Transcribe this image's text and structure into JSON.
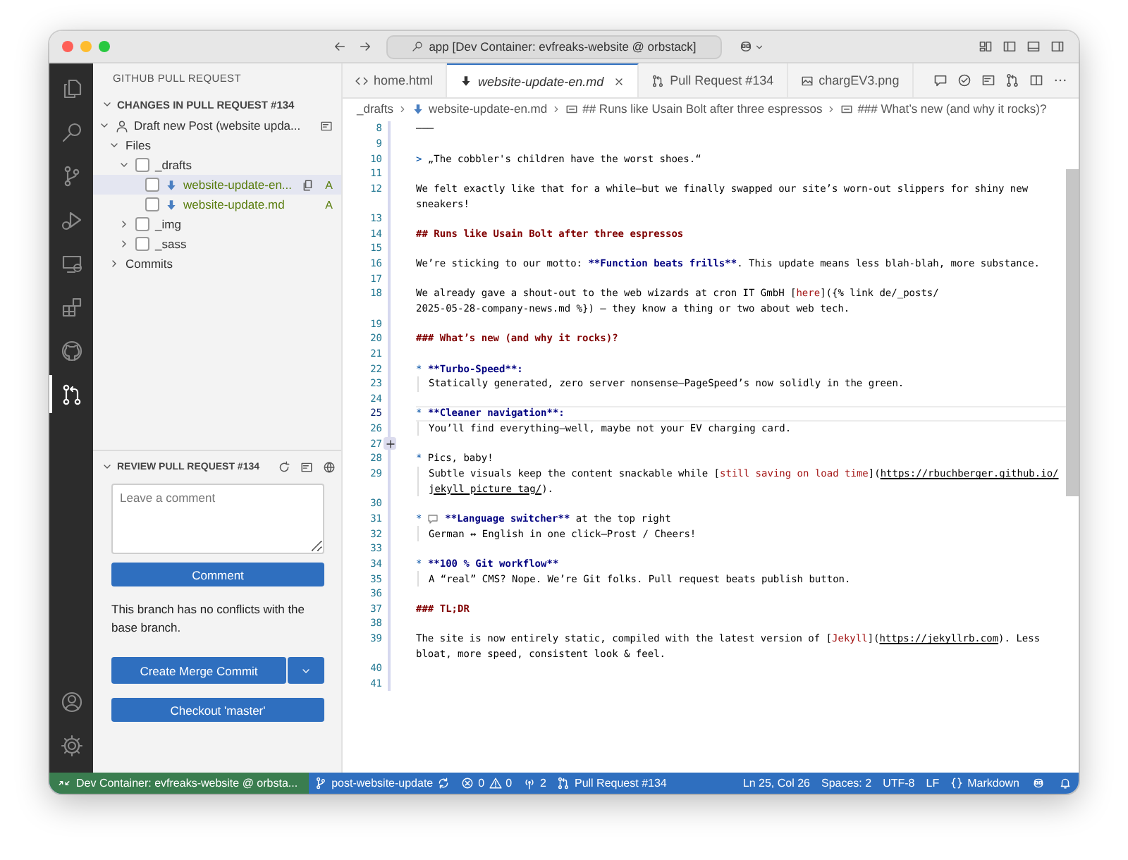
{
  "window": {
    "title": "app [Dev Container: evfreaks-website @ orbstack]"
  },
  "activity_bar": [
    {
      "kind": "files",
      "selected": false
    },
    {
      "kind": "search",
      "selected": false
    },
    {
      "kind": "branch",
      "selected": false
    },
    {
      "kind": "debug",
      "selected": false
    },
    {
      "kind": "remote",
      "selected": false
    },
    {
      "kind": "extensions",
      "selected": false
    },
    {
      "kind": "github",
      "selected": false
    },
    {
      "kind": "pr",
      "selected": true
    }
  ],
  "activity_bottom": [
    {
      "kind": "account"
    },
    {
      "kind": "gear"
    }
  ],
  "sidebar": {
    "title": "GITHUB PULL REQUEST",
    "changes": {
      "title": "CHANGES IN PULL REQUEST #134",
      "expanded": true,
      "tree": [
        {
          "kind": "pr",
          "label": "Draft new Post (website upda...",
          "expanded": true,
          "selected": false,
          "children": [
            {
              "kind": "group",
              "label": "Files",
              "expanded": true,
              "selected": false,
              "children": [
                {
                  "kind": "folder",
                  "label": "_drafts",
                  "expanded": true,
                  "checked": false,
                  "selected": false,
                  "children": [
                    {
                      "kind": "file",
                      "label": "website-update-en...",
                      "checked": false,
                      "selected": true,
                      "status": "A"
                    },
                    {
                      "kind": "file",
                      "label": "website-update.md",
                      "checked": false,
                      "selected": false,
                      "status": "A"
                    }
                  ]
                },
                {
                  "kind": "folder",
                  "label": "_img",
                  "expanded": false,
                  "checked": false,
                  "selected": false
                },
                {
                  "kind": "folder",
                  "label": "_sass",
                  "expanded": false,
                  "checked": false,
                  "selected": false
                }
              ]
            },
            {
              "kind": "group",
              "label": "Commits",
              "expanded": false,
              "selected": false
            }
          ]
        }
      ]
    },
    "review": {
      "title": "REVIEW PULL REQUEST #134",
      "expanded": true,
      "placeholder": "Leave a comment",
      "comment_button": "Comment",
      "message": "This branch has no conflicts with the base branch.",
      "merge_button": "Create Merge Commit",
      "checkout_button": "Checkout 'master'"
    }
  },
  "tabs": [
    {
      "label": "home.html",
      "kind": "html",
      "selected": false
    },
    {
      "label": "website-update-en.md",
      "kind": "markdown",
      "selected": true
    },
    {
      "label": "Pull Request #134",
      "kind": "pr",
      "selected": false
    },
    {
      "label": "chargEV3.png",
      "kind": "image",
      "selected": false
    }
  ],
  "breadcrumbs": [
    {
      "label": "_drafts",
      "kind": "folder"
    },
    {
      "label": "website-update-en.md",
      "kind": "markdown"
    },
    {
      "label": "## Runs like Usain Bolt after three espressos",
      "kind": "symbol"
    },
    {
      "label": "### What’s new (and why it rocks)?",
      "kind": "symbol"
    }
  ],
  "editor": {
    "rows": [
      {
        "number": "8",
        "segs": [
          {
            "kind": "text",
            "text": "–––"
          }
        ]
      },
      {
        "number": "9",
        "segs": []
      },
      {
        "number": "10",
        "segs": [
          {
            "kind": "mark",
            "text": ">"
          },
          {
            "kind": "text",
            "text": " „The cobbler's children have the worst shoes.“"
          }
        ]
      },
      {
        "number": "11",
        "segs": []
      },
      {
        "number": "12",
        "segs": [
          {
            "kind": "text",
            "text": "We felt exactly like that for a while—but we finally swapped our site’s worn-out slippers for shiny new"
          }
        ]
      },
      {
        "segs": [
          {
            "kind": "text",
            "text": "sneakers!"
          }
        ]
      },
      {
        "number": "13",
        "segs": []
      },
      {
        "number": "14",
        "segs": [
          {
            "kind": "heading",
            "text": "## Runs like Usain Bolt after three espressos"
          }
        ]
      },
      {
        "number": "15",
        "segs": []
      },
      {
        "number": "16",
        "segs": [
          {
            "kind": "text",
            "text": "We’re sticking to our motto: "
          },
          {
            "kind": "strong",
            "text": "**Function beats frills**"
          },
          {
            "kind": "text",
            "text": ". This update means less blah-blah, more substance."
          }
        ]
      },
      {
        "number": "17",
        "segs": []
      },
      {
        "number": "18",
        "segs": [
          {
            "kind": "text",
            "text": "We already gave a shout-out to the web wizards at cron IT GmbH ["
          },
          {
            "kind": "link",
            "text": "here"
          },
          {
            "kind": "text",
            "text": "]({% link de/_posts/"
          }
        ]
      },
      {
        "segs": [
          {
            "kind": "text",
            "text": "2025-05-28-company-news.md %}) — they know a thing or two about web tech."
          }
        ]
      },
      {
        "number": "19",
        "segs": []
      },
      {
        "number": "20",
        "segs": [
          {
            "kind": "heading",
            "text": "### What’s new (and why it rocks)?"
          }
        ]
      },
      {
        "number": "21",
        "segs": []
      },
      {
        "number": "22",
        "segs": [
          {
            "kind": "mark",
            "text": "* "
          },
          {
            "kind": "strong",
            "text": "**Turbo-Speed**:"
          }
        ]
      },
      {
        "number": "23",
        "indent": true,
        "segs": [
          {
            "kind": "text",
            "text": "Statically generated, zero server nonsense—PageSpeed’s now solidly in the green."
          }
        ]
      },
      {
        "number": "24",
        "segs": []
      },
      {
        "number": "25",
        "current": true,
        "segs": [
          {
            "kind": "mark",
            "text": "* "
          },
          {
            "kind": "strong",
            "text": "**Cleaner navigation**:"
          }
        ]
      },
      {
        "number": "26",
        "indent": true,
        "segs": [
          {
            "kind": "text",
            "text": "You’ll find everything—well, maybe not your EV charging card."
          }
        ]
      },
      {
        "number": "27",
        "add_comment": true,
        "segs": []
      },
      {
        "number": "28",
        "segs": [
          {
            "kind": "mark",
            "text": "*"
          },
          {
            "kind": "text",
            "text": " Pics, baby!"
          }
        ]
      },
      {
        "number": "29",
        "indent": true,
        "segs": [
          {
            "kind": "text",
            "text": "Subtle visuals keep the content snackable while ["
          },
          {
            "kind": "link",
            "text": "still saving on load time"
          },
          {
            "kind": "text",
            "text": "]("
          },
          {
            "kind": "url",
            "text": "https://rbuchberger.github.io/"
          }
        ]
      },
      {
        "indent": true,
        "segs": [
          {
            "kind": "url",
            "text": "jekyll_picture_tag/"
          },
          {
            "kind": "text",
            "text": ")."
          }
        ]
      },
      {
        "number": "30",
        "segs": []
      },
      {
        "number": "31",
        "segs": [
          {
            "kind": "mark",
            "text": "* "
          },
          {
            "kind": "icon"
          },
          {
            "kind": "strong",
            "text": " **Language switcher**"
          },
          {
            "kind": "text",
            "text": " at the top right"
          }
        ]
      },
      {
        "number": "32",
        "indent": true,
        "segs": [
          {
            "kind": "text",
            "text": "German ↔ English in one click—Prost / Cheers!"
          }
        ]
      },
      {
        "number": "33",
        "segs": []
      },
      {
        "number": "34",
        "segs": [
          {
            "kind": "mark",
            "text": "* "
          },
          {
            "kind": "strong",
            "text": "**100 % Git workflow**"
          }
        ]
      },
      {
        "number": "35",
        "indent": true,
        "segs": [
          {
            "kind": "text",
            "text": "A “real” CMS? Nope. We’re Git folks. Pull request beats publish button."
          }
        ]
      },
      {
        "number": "36",
        "segs": []
      },
      {
        "number": "37",
        "segs": [
          {
            "kind": "heading",
            "text": "### TL;DR"
          }
        ]
      },
      {
        "number": "38",
        "segs": []
      },
      {
        "number": "39",
        "segs": [
          {
            "kind": "text",
            "text": "The site is now entirely static, compiled with the latest version of ["
          },
          {
            "kind": "link",
            "text": "Jekyll"
          },
          {
            "kind": "text",
            "text": "]("
          },
          {
            "kind": "url",
            "text": "https://jekyllrb.com"
          },
          {
            "kind": "text",
            "text": "). Less"
          }
        ]
      },
      {
        "segs": [
          {
            "kind": "text",
            "text": "bloat, more speed, consistent look & feel."
          }
        ]
      },
      {
        "number": "40",
        "segs": []
      },
      {
        "number": "41",
        "segs": []
      }
    ]
  },
  "status_bar": {
    "remote": "Dev Container: evfreaks-website @ orbsta...",
    "left_items": [
      {
        "kind": "branch",
        "text": "post-website-update"
      },
      {
        "kind": "problems",
        "errors": "0",
        "warnings": "0"
      },
      {
        "kind": "ports",
        "text": "2"
      },
      {
        "kind": "pr",
        "text": "Pull Request #134"
      }
    ],
    "right_items": [
      {
        "kind": "text",
        "text": "Ln 25, Col 26"
      },
      {
        "kind": "text",
        "text": "Spaces: 2"
      },
      {
        "kind": "text",
        "text": "UTF-8"
      },
      {
        "kind": "text",
        "text": "LF"
      },
      {
        "kind": "language",
        "text": "Markdown"
      },
      {
        "kind": "robot"
      },
      {
        "kind": "bell"
      }
    ]
  }
}
